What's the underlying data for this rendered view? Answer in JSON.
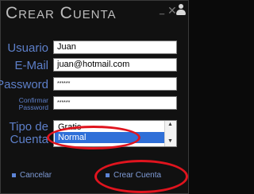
{
  "window": {
    "title": "Crear Cuenta"
  },
  "form": {
    "usuario_label": "Usuario",
    "usuario_value": "Juan",
    "email_label": "E-Mail",
    "email_value": "juan@hotmail.com",
    "password_label": "Password",
    "password_value": "******",
    "confirm_label_line1": "Confirmar",
    "confirm_label_line2": "Password",
    "confirm_value": "******",
    "tipo_label_line1": "Tipo de",
    "tipo_label_line2": "Cuenta",
    "tipo_options": [
      "Gratis",
      "Normal"
    ],
    "tipo_selected": "Normal"
  },
  "buttons": {
    "cancel_label": "Cancelar",
    "create_label": "Crear Cuenta"
  },
  "colors": {
    "label_blue": "#5d7fc9",
    "highlight_red": "#e0141e",
    "selection_blue": "#2f6fd8"
  }
}
